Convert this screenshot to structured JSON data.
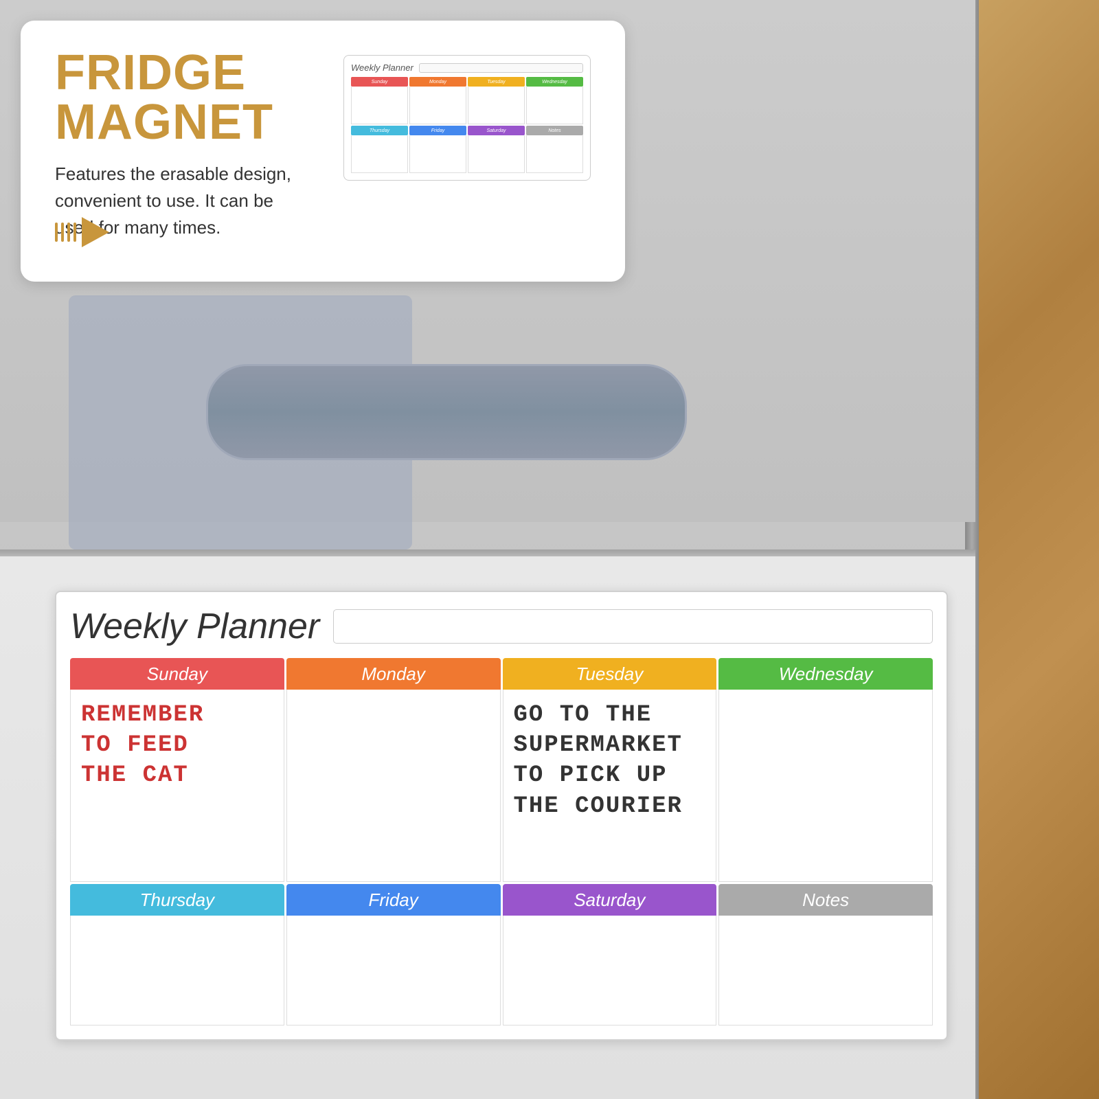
{
  "promo": {
    "title": "FRIDGE MAGNET",
    "description": "Features the erasable design, convenient to use. It can be used for many times."
  },
  "planner": {
    "title": "Weekly Planner",
    "days_top": [
      {
        "name": "Sunday",
        "color_class": "sunday-bg",
        "note": "REMEMBER\nTO FEED\nTHE CAT",
        "note_color": "sunday-note"
      },
      {
        "name": "Monday",
        "color_class": "monday-bg",
        "note": "",
        "note_color": ""
      },
      {
        "name": "Tuesday",
        "color_class": "tuesday-bg",
        "note": "GO TO THE\nSUPERMARKET\nTO PICK UP\nTHE COURIER",
        "note_color": "tuesday-note"
      },
      {
        "name": "Wednesday",
        "color_class": "wednesday-bg",
        "note": "",
        "note_color": ""
      }
    ],
    "days_bottom": [
      {
        "name": "Thursday",
        "color_class": "thursday-bg"
      },
      {
        "name": "Friday",
        "color_class": "friday-bg"
      },
      {
        "name": "Saturday",
        "color_class": "saturday-bg"
      },
      {
        "name": "Notes",
        "color_class": "notes-bg"
      }
    ]
  },
  "small_planner": {
    "title": "Weekly Planner",
    "days_top": [
      {
        "name": "Sunday",
        "color_class": "sunday-bg"
      },
      {
        "name": "Monday",
        "color_class": "monday-bg"
      },
      {
        "name": "Tuesday",
        "color_class": "tuesday-bg"
      },
      {
        "name": "Wednesday",
        "color_class": "wednesday-bg"
      }
    ],
    "days_bottom": [
      {
        "name": "Thursday",
        "color_class": "thursday-bg"
      },
      {
        "name": "Friday",
        "color_class": "friday-bg"
      },
      {
        "name": "Saturday",
        "color_class": "saturday-bg"
      },
      {
        "name": "Notes",
        "color_class": "notes-bg"
      }
    ]
  }
}
